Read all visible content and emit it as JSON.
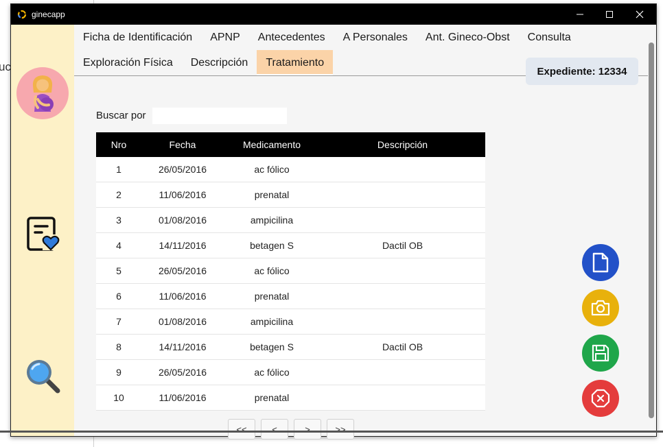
{
  "window": {
    "title": "ginecapp",
    "controls": {
      "minimize": "minimize-icon",
      "maximize": "maximize-icon",
      "close": "close-icon"
    }
  },
  "background": {
    "partial_text": "uc"
  },
  "sidebar": {
    "avatar_icon": "pregnant-woman-icon",
    "items": [
      {
        "icon": "document-heart-icon"
      },
      {
        "icon": "magnifier-icon"
      }
    ]
  },
  "tabs": {
    "row1": [
      "Ficha de Identificación",
      "APNP",
      "Antecedentes",
      "A Personales",
      "Ant. Gineco-Obst",
      "Consulta"
    ],
    "row2": [
      "Exploración Física",
      "Descripción",
      "Tratamiento"
    ],
    "active": "Tratamiento"
  },
  "expediente": {
    "label": "Expediente: 12334"
  },
  "search": {
    "label": "Buscar por",
    "value": ""
  },
  "table": {
    "headers": [
      "Nro",
      "Fecha",
      "Medicamento",
      "Descripción"
    ],
    "rows": [
      [
        "1",
        "26/05/2016",
        "ac fólico",
        ""
      ],
      [
        "2",
        "11/06/2016",
        "prenatal",
        ""
      ],
      [
        "3",
        "01/08/2016",
        "ampicilina",
        ""
      ],
      [
        "4",
        "14/11/2016",
        "betagen S",
        "Dactil OB"
      ],
      [
        "5",
        "26/05/2016",
        "ac fólico",
        ""
      ],
      [
        "6",
        "11/06/2016",
        "prenatal",
        ""
      ],
      [
        "7",
        "01/08/2016",
        "ampicilina",
        ""
      ],
      [
        "8",
        "14/11/2016",
        "betagen S",
        "Dactil OB"
      ],
      [
        "9",
        "26/05/2016",
        "ac fólico",
        ""
      ],
      [
        "10",
        "11/06/2016",
        "prenatal",
        ""
      ]
    ]
  },
  "pagination": {
    "first": "<<",
    "prev": "<",
    "next": ">",
    "last": ">>"
  },
  "actions": [
    {
      "name": "new-document-button",
      "icon": "document-icon",
      "color": "#2251c8"
    },
    {
      "name": "camera-button",
      "icon": "camera-icon",
      "color": "#e8b10c"
    },
    {
      "name": "save-button",
      "icon": "floppy-disk-icon",
      "color": "#1fa64a"
    },
    {
      "name": "cancel-button",
      "icon": "stop-x-icon",
      "color": "#e43c3c"
    }
  ]
}
